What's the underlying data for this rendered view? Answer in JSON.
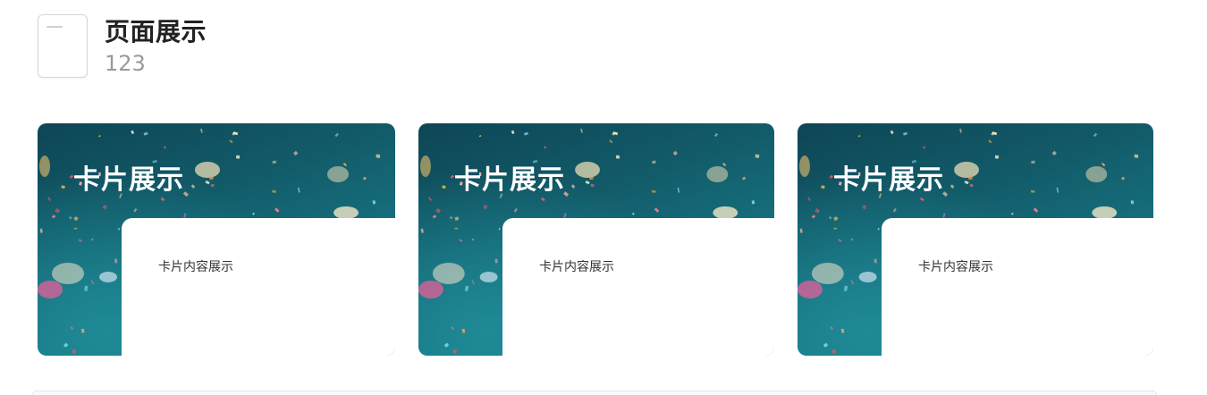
{
  "header": {
    "title": "页面展示",
    "subtitle": "123",
    "icon": "document-icon"
  },
  "cards": [
    {
      "title": "卡片展示",
      "content": "卡片内容展示"
    },
    {
      "title": "卡片展示",
      "content": "卡片内容展示"
    },
    {
      "title": "卡片展示",
      "content": "卡片内容展示"
    }
  ],
  "colors": {
    "card_background": "#125a68",
    "card_panel": "#ffffff",
    "title_text": "#222222",
    "subtitle_text": "#9a9a9a"
  }
}
